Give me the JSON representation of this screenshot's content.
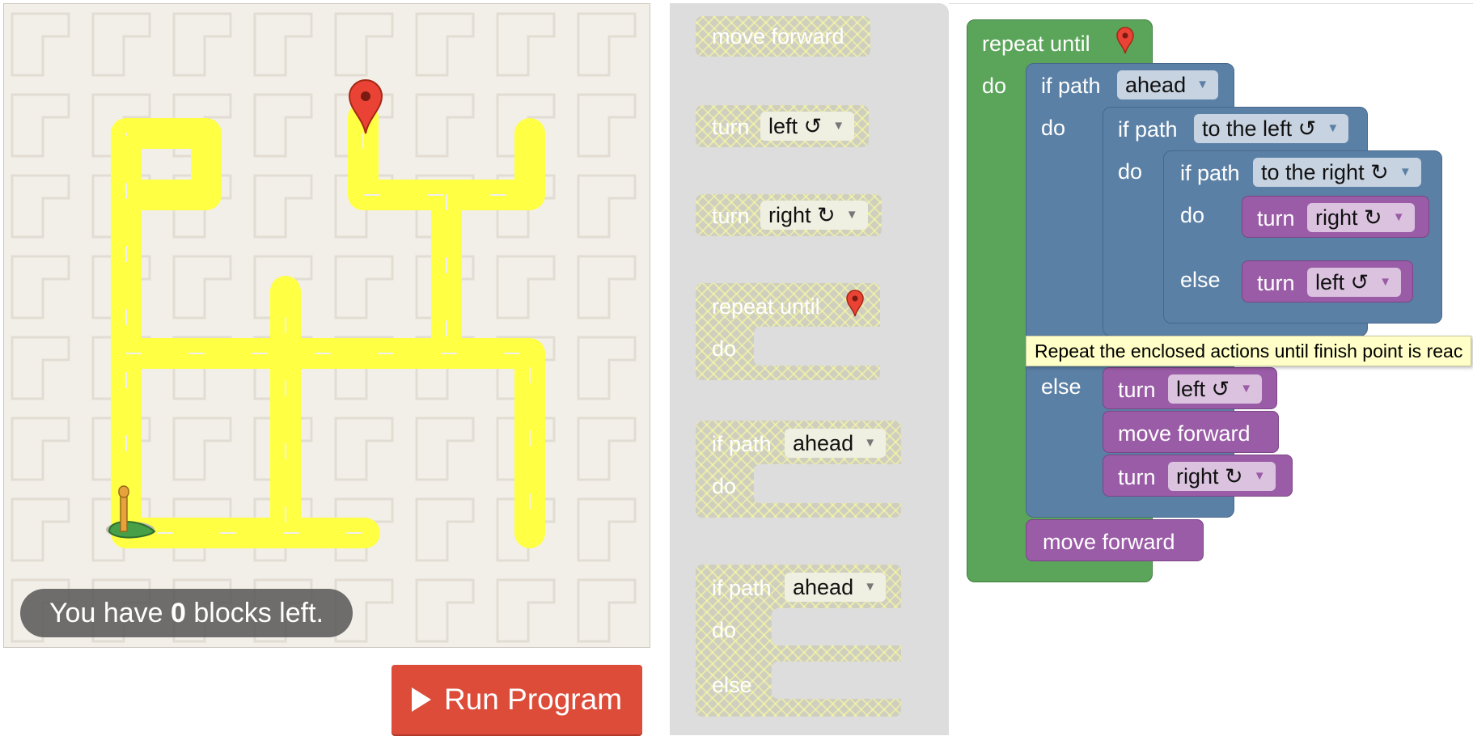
{
  "maze": {
    "blocks_left_prefix": "You have ",
    "blocks_left_count": "0",
    "blocks_left_suffix": " blocks left."
  },
  "run_button": {
    "label": "Run Program"
  },
  "toolbox": {
    "move_forward": "move forward",
    "turn_left_label": "turn",
    "turn_left_value": "left ↺",
    "turn_right_label": "turn",
    "turn_right_value": "right ↻",
    "repeat_label": "repeat until",
    "repeat_do": "do",
    "if_label": "if path",
    "if_value": "ahead",
    "if_do": "do",
    "ifelse_label": "if path",
    "ifelse_value": "ahead",
    "ifelse_do": "do",
    "ifelse_else": "else"
  },
  "workspace": {
    "repeat_label": "repeat until",
    "repeat_do": "do",
    "if1_label": "if path",
    "if1_value": "ahead",
    "if1_do": "do",
    "if1_else": "else",
    "if2_label": "if path",
    "if2_value": "to the left ↺",
    "if2_do": "do",
    "if3_label": "if path",
    "if3_value": "to the right ↻",
    "if3_do": "do",
    "if3_else": "else",
    "turn_right_a_label": "turn",
    "turn_right_a_value": "right ↻",
    "turn_left_a_label": "turn",
    "turn_left_a_value": "left ↺",
    "turn_left_b_label": "turn",
    "turn_left_b_value": "left ↺",
    "move_forward_a": "move forward",
    "turn_right_b_label": "turn",
    "turn_right_b_value": "right ↻",
    "move_forward_b": "move forward"
  },
  "tooltip": "Repeat the enclosed actions until finish point is reac",
  "colors": {
    "loop_green": "#5ba55b",
    "logic_blue": "#5b80a5",
    "action_purple": "#9a5ca6",
    "road_yellow": "#ffff44",
    "run_red": "#dd4b39",
    "marker_red": "#ea4335"
  },
  "icons": [
    "map-marker-icon",
    "pegman-icon",
    "play-icon",
    "dropdown-arrow-icon"
  ]
}
